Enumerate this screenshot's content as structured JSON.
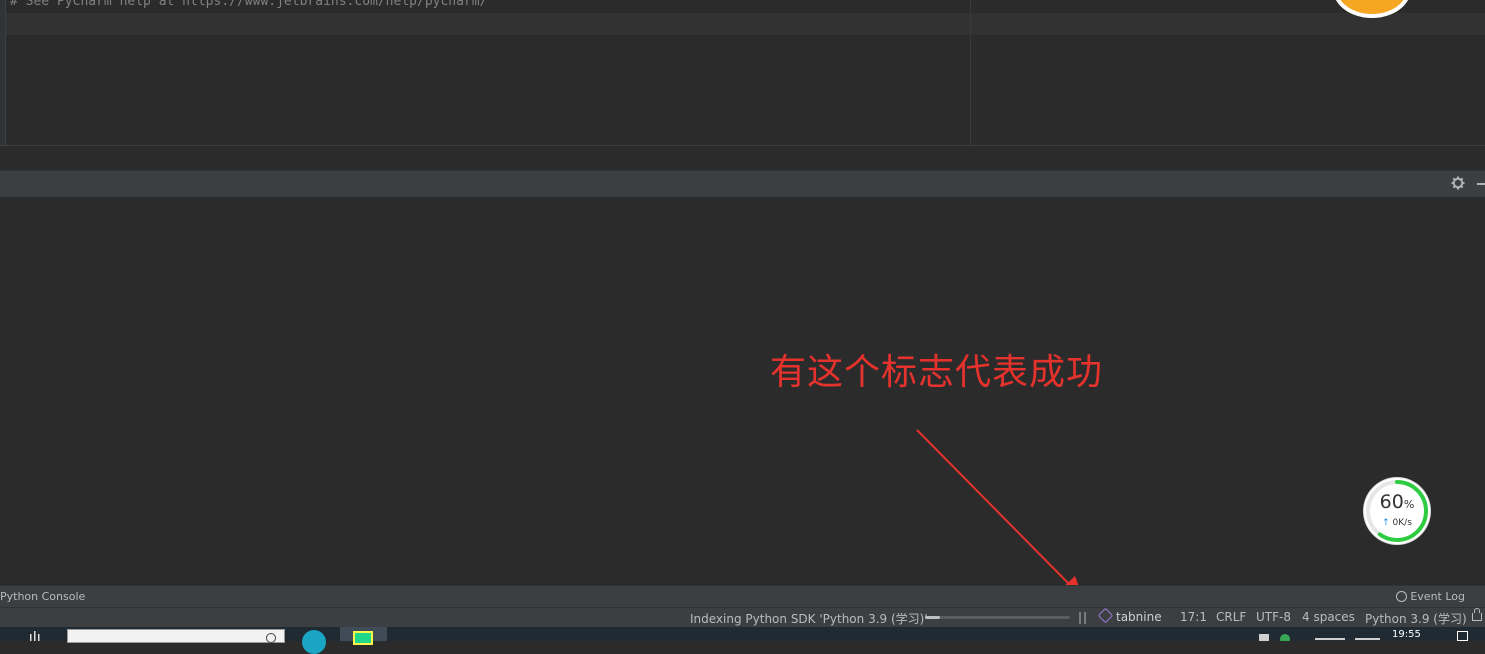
{
  "editor": {
    "comment_line": "# See PyCharm help at https://www.jetbrains.com/help/pycharm/"
  },
  "annotation": {
    "text": "有这个标志代表成功",
    "color": "#e5322d"
  },
  "speed_widget": {
    "percent": "60",
    "percent_sign": "%",
    "rate": "0K/s",
    "fraction": 0.6,
    "ring_color": "#2ecc40"
  },
  "tool_stripe": {
    "console_label": "Python Console",
    "event_log_label": "Event Log"
  },
  "status_bar": {
    "indexing_text": "Indexing Python SDK 'Python 3.9 (学习)'",
    "indexing_progress": 0.1,
    "tabnine_label": "tabnine",
    "position": "17:1",
    "line_separator": "CRLF",
    "encoding": "UTF-8",
    "indent": "4 spaces",
    "interpreter": "Python 3.9 (学习)"
  },
  "taskbar": {
    "clock": "19:55"
  },
  "icons": {
    "gear": "gear-icon",
    "minimize": "minimize-icon",
    "event_log": "event-log-icon",
    "tabnine": "tabnine-icon",
    "lock": "lock-icon",
    "pause": "pause-icon"
  }
}
